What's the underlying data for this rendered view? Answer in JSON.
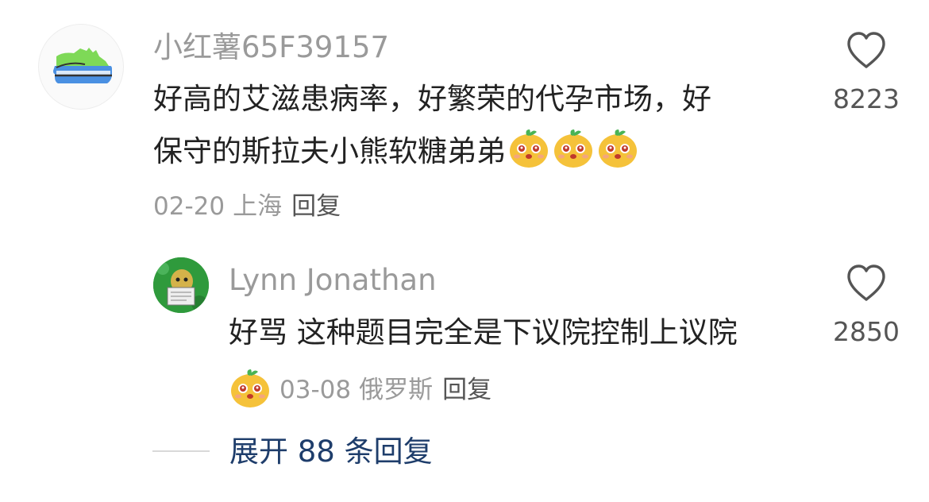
{
  "comments": [
    {
      "username": "小红薯65F39157",
      "content_line1": "好高的艾滋患病率，好繁荣的代孕市场，好",
      "content_line2": "保守的斯拉夫小熊软糖弟弟",
      "date": "02-20",
      "location": "上海",
      "reply_label": "回复",
      "like_count": "8223",
      "emoji_count": 3
    }
  ],
  "reply": {
    "username": "Lynn Jonathan",
    "content": "好骂 这种题目完全是下议院控制上议院",
    "date": "03-08",
    "location": "俄罗斯",
    "reply_label": "回复",
    "like_count": "2850"
  },
  "expand_replies_label": "展开 88 条回复",
  "colors": {
    "username": "#9a9a9a",
    "content": "#222222",
    "meta": "#9a9a9a",
    "expand_link": "#1e3d6b"
  },
  "icons": {
    "like": "heart-outline-icon",
    "avatar_main": "sneaker-icon",
    "emoji": "potato-face-emoji"
  }
}
